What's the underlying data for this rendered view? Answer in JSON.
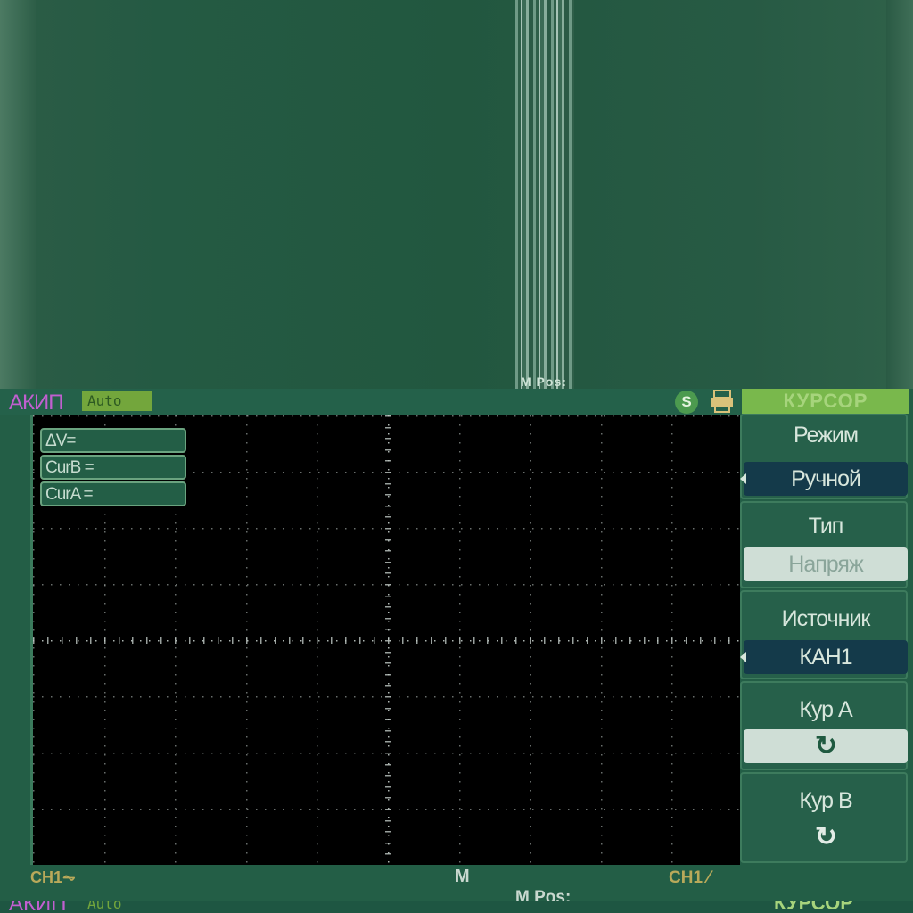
{
  "smear": {
    "ghost_text": "M Pos:"
  },
  "header": {
    "brand": "АКИП",
    "trigger_mode": "Auto",
    "usb_icon": "usb-icon",
    "printer_icon": "printer-icon"
  },
  "cursor_readouts": [
    {
      "label": "ΔV="
    },
    {
      "label": "CurB ="
    },
    {
      "label": "CurA ="
    }
  ],
  "status": {
    "ch1_coupling": "CH1⏦",
    "timebase": "M",
    "trigger_source": "CH1 ⁄",
    "m_pos": "M Pos:"
  },
  "menu": {
    "title": "КУРСОР",
    "items": [
      {
        "label": "Режим",
        "value": "Ручной",
        "style": "dark",
        "arrow": true
      },
      {
        "label": "Тип",
        "value": "Напряж",
        "style": "light",
        "arrow": false
      },
      {
        "label": "Источник",
        "value": "КАН1",
        "style": "dark",
        "arrow": true
      },
      {
        "label": "Кур A",
        "value": "↻",
        "style": "light",
        "arrow": false
      },
      {
        "label": "Кур B",
        "value": "↻",
        "style": "none",
        "arrow": false
      }
    ]
  },
  "sliver": {
    "brand": "АКИП",
    "trigger_mode": "Auto",
    "menu_title": "КУРСОР"
  },
  "colors": {
    "brand": "#c15fd0",
    "trigger_badge": "#73a63c",
    "menu_title": "#79b84c",
    "channel_label": "#b9a95a",
    "grid_dot": "#bfc8c4"
  }
}
